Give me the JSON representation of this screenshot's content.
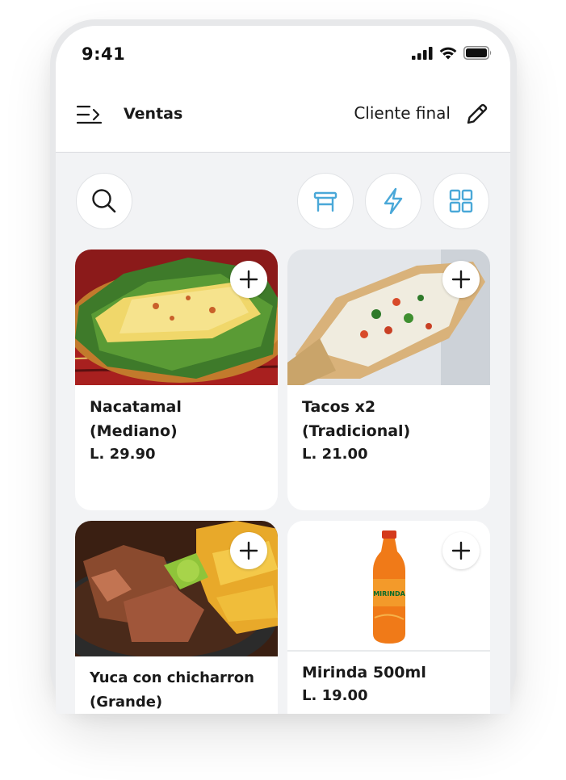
{
  "status_bar": {
    "time": "9:41"
  },
  "header": {
    "title": "Ventas",
    "client_label": "Cliente final"
  },
  "colors": {
    "accent": "#4aa8d8",
    "text": "#1a1a1a",
    "background": "#f2f3f5"
  },
  "toolbar": {
    "search_icon": "search-icon",
    "table_icon": "table-icon",
    "flash_icon": "lightning-icon",
    "grid_icon": "grid-icon"
  },
  "products": [
    {
      "name": "Nacatamal\n(Mediano)",
      "price": "L. 29.90"
    },
    {
      "name": "Tacos x2\n(Tradicional)",
      "price": "L. 21.00"
    },
    {
      "name": "Yuca con chicharron\n(Grande)",
      "price": ""
    },
    {
      "name": "Mirinda 500ml",
      "price": "L. 19.00",
      "bottle_label": "MIRINDA"
    }
  ]
}
